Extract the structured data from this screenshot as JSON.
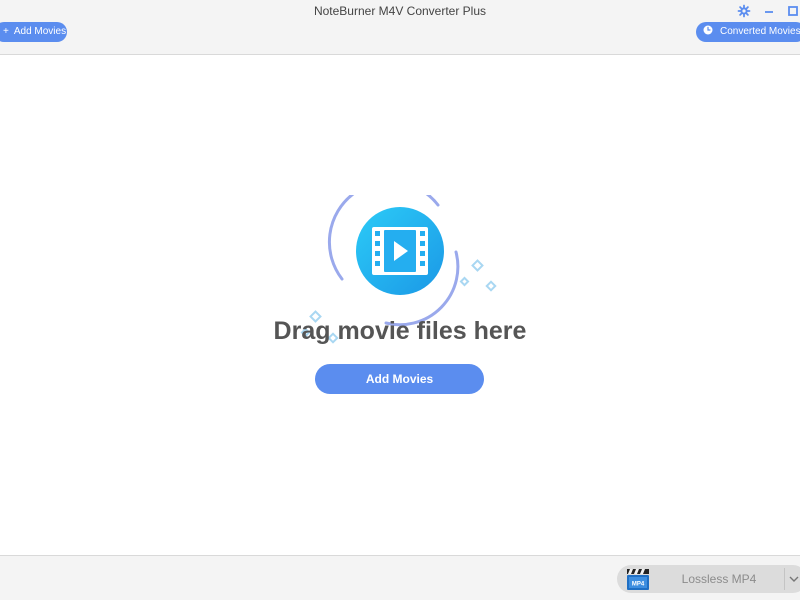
{
  "window": {
    "title": "NoteBurner M4V Converter Plus"
  },
  "toolbar": {
    "add_movies_label": "Add Movies",
    "converted_movies_label": "Converted Movies",
    "icons": [
      "plus-icon",
      "clock-icon",
      "gear-icon",
      "minimize-icon",
      "maximize-icon"
    ]
  },
  "dropzone": {
    "headline": "Drag movie files here",
    "add_movies_button_label": "Add Movies",
    "illustration_icon": "film-play-icon"
  },
  "output": {
    "format_selected": "Lossless MP4",
    "format_icon": "mp4-clapperboard-icon"
  },
  "colors": {
    "accent": "#5b8def",
    "illustration_gradient_start": "#27c4f5",
    "illustration_gradient_end": "#1a9ce8",
    "headline_text": "#555555",
    "bar_background": "#f4f4f4"
  }
}
